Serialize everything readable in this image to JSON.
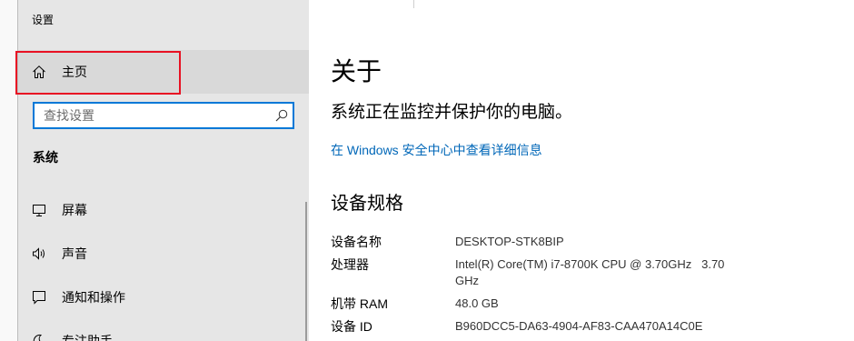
{
  "window": {
    "title": "设置"
  },
  "sidebar": {
    "home": {
      "label": "主页",
      "icon": "home-icon"
    },
    "search": {
      "placeholder": "查找设置",
      "icon": "search-icon"
    },
    "section_title": "系统",
    "items": [
      {
        "label": "屏幕",
        "icon": "monitor-icon"
      },
      {
        "label": "声音",
        "icon": "speaker-icon"
      },
      {
        "label": "通知和操作",
        "icon": "notification-icon"
      },
      {
        "label": "专注助手",
        "icon": "moon-icon"
      }
    ]
  },
  "main": {
    "title": "关于",
    "protection_status": "系统正在监控并保护你的电脑。",
    "security_link": "在 Windows 安全中心中查看详细信息",
    "specs_title": "设备规格",
    "specs": [
      {
        "label": "设备名称",
        "value": "DESKTOP-STK8BIP"
      },
      {
        "label": "处理器",
        "value": "Intel(R) Core(TM) i7-8700K CPU @ 3.70GHz   3.70 GHz"
      },
      {
        "label": "机带 RAM",
        "value": "48.0 GB"
      },
      {
        "label": "设备 ID",
        "value": "B960DCC5-DA63-4904-AF83-CAA470A14C0E"
      }
    ]
  },
  "colors": {
    "accent": "#0078d7",
    "link": "#0067b8",
    "sidebar_bg": "#e6e6e6",
    "highlight_bg": "#d9d9d9",
    "annotation": "#e81123"
  }
}
